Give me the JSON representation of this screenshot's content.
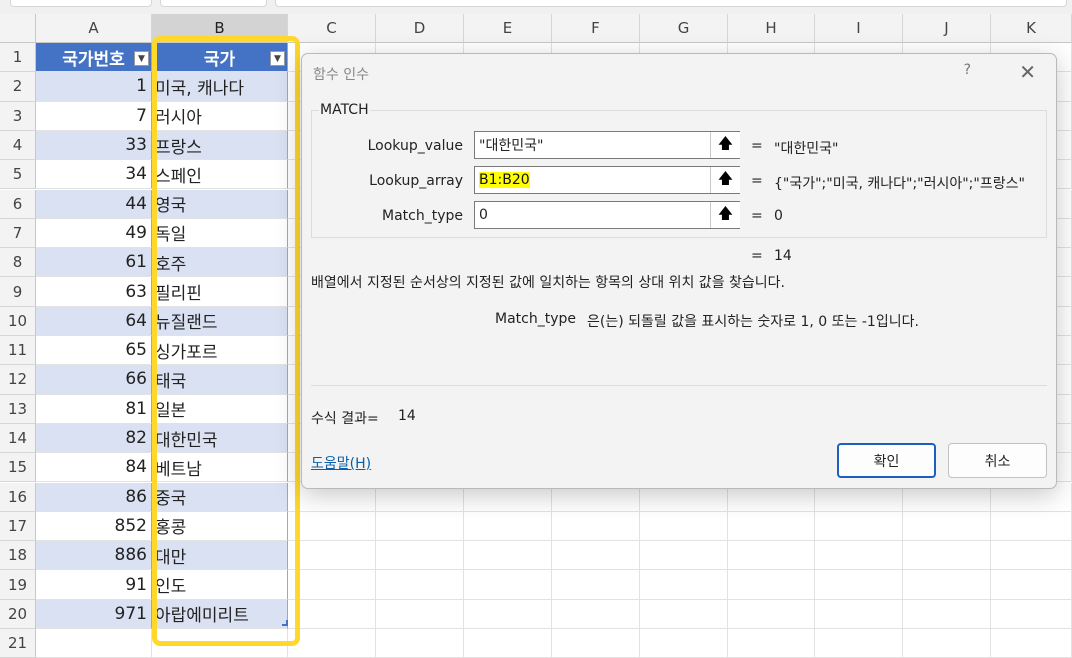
{
  "columns": [
    "A",
    "B",
    "C",
    "D",
    "E",
    "F",
    "G",
    "H",
    "I",
    "J",
    "K"
  ],
  "rows": [
    "1",
    "2",
    "3",
    "4",
    "5",
    "6",
    "7",
    "8",
    "9",
    "10",
    "11",
    "12",
    "13",
    "14",
    "15",
    "16",
    "17",
    "18",
    "19",
    "20",
    "21"
  ],
  "table": {
    "header_a": "국가번호",
    "header_b": "국가",
    "rows": [
      {
        "code": "1",
        "country": "미국, 캐나다"
      },
      {
        "code": "7",
        "country": "러시아"
      },
      {
        "code": "33",
        "country": "프랑스"
      },
      {
        "code": "34",
        "country": "스페인"
      },
      {
        "code": "44",
        "country": "영국"
      },
      {
        "code": "49",
        "country": "독일"
      },
      {
        "code": "61",
        "country": "호주"
      },
      {
        "code": "63",
        "country": "필리핀"
      },
      {
        "code": "64",
        "country": "뉴질랜드"
      },
      {
        "code": "65",
        "country": "싱가포르"
      },
      {
        "code": "66",
        "country": "태국"
      },
      {
        "code": "81",
        "country": "일본"
      },
      {
        "code": "82",
        "country": "대한민국"
      },
      {
        "code": "84",
        "country": "베트남"
      },
      {
        "code": "86",
        "country": "중국"
      },
      {
        "code": "852",
        "country": "홍콩"
      },
      {
        "code": "886",
        "country": "대만"
      },
      {
        "code": "91",
        "country": "인도"
      },
      {
        "code": "971",
        "country": "아랍에미리트"
      }
    ]
  },
  "dialog": {
    "title": "함수 인수",
    "help_icon": "?",
    "close_icon": "✕",
    "function_name": "MATCH",
    "args": [
      {
        "label": "Lookup_value",
        "value": "\"대한민국\"",
        "result": "\"대한민국\""
      },
      {
        "label": "Lookup_array",
        "value": "B1:B20",
        "result": "{\"국가\";\"미국, 캐나다\";\"러시아\";\"프랑스\""
      },
      {
        "label": "Match_type",
        "value": "0",
        "result": "0"
      }
    ],
    "eq": "=",
    "formula_value": "14",
    "description": "배열에서 지정된 순서상의 지정된 값에 일치하는 항목의 상대 위치 값을 찾습니다.",
    "arg_desc_name": "Match_type",
    "arg_desc_text": "은(는) 되돌릴 값을 표시하는 숫자로 1, 0 또는 -1입니다.",
    "result_label": "수식 결과=",
    "result_value": "14",
    "help_link": "도움말(H)",
    "ok_label": "확인",
    "cancel_label": "취소"
  }
}
